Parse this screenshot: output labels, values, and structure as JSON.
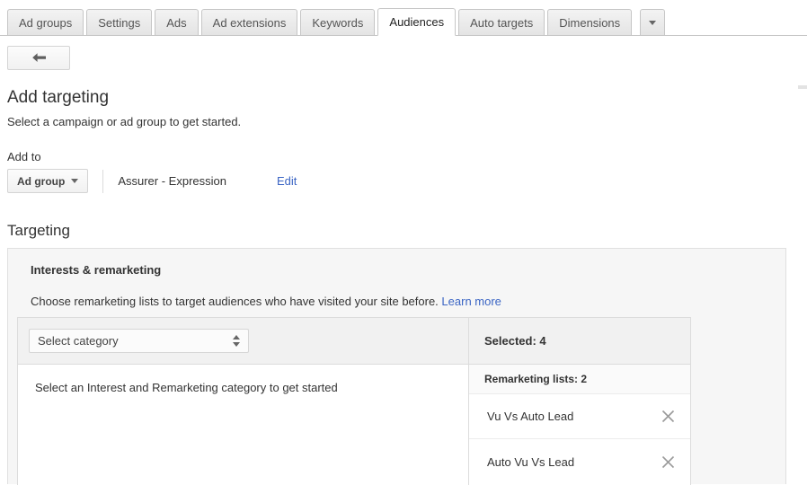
{
  "tabbar": {
    "tabs": [
      {
        "label": "Ad groups",
        "active": false
      },
      {
        "label": "Settings",
        "active": false
      },
      {
        "label": "Ads",
        "active": false
      },
      {
        "label": "Ad extensions",
        "active": false
      },
      {
        "label": "Keywords",
        "active": false
      },
      {
        "label": "Audiences",
        "active": true
      },
      {
        "label": "Auto targets",
        "active": false
      },
      {
        "label": "Dimensions",
        "active": false
      }
    ],
    "overflow_icon": "chevron-down-icon"
  },
  "toolbar": {
    "back_icon": "arrow-left-icon"
  },
  "page": {
    "title": "Add targeting",
    "subtitle": "Select a campaign or ad group to get started."
  },
  "add_to": {
    "label": "Add to",
    "scope_button": "Ad group",
    "scope_caret_icon": "caret-down-icon",
    "entity_name": "Assurer - Expression",
    "edit_link": "Edit"
  },
  "targeting": {
    "section_title": "Targeting",
    "card_title": "Interests & remarketing",
    "card_description": "Choose remarketing lists to target audiences who have visited your site before.",
    "learn_more": "Learn more",
    "category_select": {
      "value": "Select category",
      "icon": "double-chevron-icon"
    },
    "empty_state": "Select an Interest and Remarketing category to get started",
    "selected_header": "Selected: 4",
    "remarketing_lists_header": "Remarketing lists: 2",
    "selected_items": [
      {
        "label": "Vu Vs Auto Lead",
        "remove_icon": "close-icon"
      },
      {
        "label": "Auto Vu Vs Lead",
        "remove_icon": "close-icon"
      }
    ]
  },
  "colors": {
    "link": "#3b65c4",
    "border": "#dcdcdc",
    "panel": "#f6f6f6",
    "tab_active": "#ffffff"
  }
}
